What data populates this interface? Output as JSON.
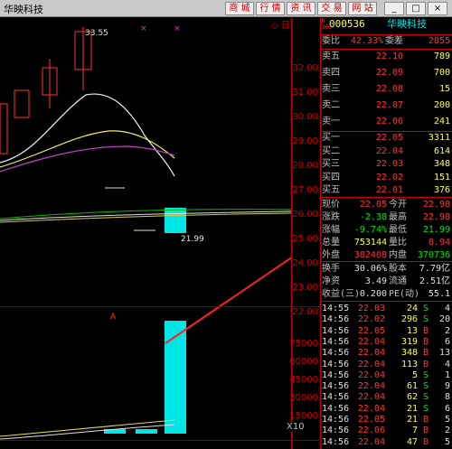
{
  "app": {
    "title": "华映科技"
  },
  "toolbar": {
    "buttons": [
      "商 城",
      "行 情",
      "资 讯",
      "交 易",
      "网 站"
    ],
    "win": [
      "_",
      "□",
      "×"
    ]
  },
  "header": {
    "code_prefix": "R\n300",
    "code": "000536",
    "name": "华映科技"
  },
  "chart": {
    "hi_label": "33.55",
    "lo_label": "21.99",
    "price_ticks": [
      "32.00",
      "31.00",
      "30.00",
      "29.00",
      "28.00",
      "27.00",
      "26.00",
      "25.00",
      "24.00",
      "23.00",
      "22.00"
    ],
    "vol_ticks": [
      "75000",
      "60000",
      "45000",
      "30000",
      "15000"
    ],
    "vol_multiplier": "X10",
    "small_label": "A",
    "diamond_label": "◇ 日"
  },
  "quote": {
    "wb": {
      "label1": "委比",
      "v1": "42.33%",
      "label2": "委差",
      "v2": "2855"
    },
    "sells": [
      {
        "label": "卖五",
        "price": "22.10",
        "vol": "789"
      },
      {
        "label": "卖四",
        "price": "22.09",
        "vol": "700"
      },
      {
        "label": "卖三",
        "price": "22.08",
        "vol": "15"
      },
      {
        "label": "卖二",
        "price": "22.07",
        "vol": "200"
      },
      {
        "label": "卖一",
        "price": "22.06",
        "vol": "241"
      }
    ],
    "buys": [
      {
        "label": "买一",
        "price": "22.05",
        "vol": "3311"
      },
      {
        "label": "买二",
        "price": "22.04",
        "vol": "614"
      },
      {
        "label": "买三",
        "price": "22.03",
        "vol": "348"
      },
      {
        "label": "买四",
        "price": "22.02",
        "vol": "151"
      },
      {
        "label": "买五",
        "price": "22.01",
        "vol": "376"
      }
    ],
    "stats": [
      {
        "l1": "现价",
        "v1": "22.05",
        "l2": "今开",
        "v2": "22.98"
      },
      {
        "l1": "涨跌",
        "v1": "-2.38",
        "l2": "最高",
        "v2": "22.98"
      },
      {
        "l1": "涨幅",
        "v1": "-9.74%",
        "l2": "最低",
        "v2": "21.99"
      },
      {
        "l1": "总量",
        "v1": "753144",
        "l2": "量比",
        "v2": "8.94"
      },
      {
        "l1": "外盘",
        "v1": "382408",
        "l2": "内盘",
        "v2": "370736"
      }
    ],
    "stats2": [
      {
        "l1": "换手",
        "v1": "30.06%",
        "l2": "股本",
        "v2": "7.79亿"
      },
      {
        "l1": "净资",
        "v1": "3.49",
        "l2": "流通",
        "v2": "2.51亿"
      },
      {
        "l1": "收益(三)",
        "v1": "0.200",
        "l2": "PE(动)",
        "v2": "55.1"
      }
    ],
    "ticks": [
      {
        "t": "14:55",
        "p": "22.03",
        "v": "24",
        "s": "S",
        "n": "4"
      },
      {
        "t": "14:56",
        "p": "22.02",
        "v": "296",
        "s": "S",
        "n": "20"
      },
      {
        "t": "14:56",
        "p": "22.05",
        "v": "13",
        "s": "B",
        "n": "2"
      },
      {
        "t": "14:56",
        "p": "22.04",
        "v": "319",
        "s": "B",
        "n": "6"
      },
      {
        "t": "14:56",
        "p": "22.04",
        "v": "348",
        "s": "B",
        "n": "13"
      },
      {
        "t": "14:56",
        "p": "22.04",
        "v": "113",
        "s": "B",
        "n": "4"
      },
      {
        "t": "14:56",
        "p": "22.04",
        "v": "5",
        "s": "S",
        "n": "1"
      },
      {
        "t": "14:56",
        "p": "22.04",
        "v": "61",
        "s": "S",
        "n": "9"
      },
      {
        "t": "14:56",
        "p": "22.04",
        "v": "62",
        "s": "S",
        "n": "8"
      },
      {
        "t": "14:56",
        "p": "22.04",
        "v": "21",
        "s": "S",
        "n": "6"
      },
      {
        "t": "14:56",
        "p": "22.05",
        "v": "21",
        "s": "B",
        "n": "5"
      },
      {
        "t": "14:56",
        "p": "22.06",
        "v": "7",
        "s": "B",
        "n": "2"
      },
      {
        "t": "14:56",
        "p": "22.04",
        "v": "47",
        "s": "B",
        "n": "5"
      }
    ]
  },
  "colors": {
    "up": "#ff3232",
    "down": "#00e6e6",
    "accent": "#c00000"
  }
}
